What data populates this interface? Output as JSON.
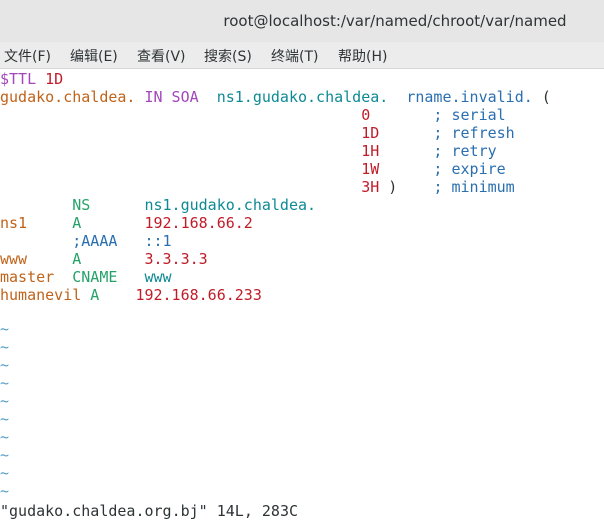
{
  "window": {
    "title": "root@localhost:/var/named/chroot/var/named"
  },
  "menu": [
    "文件(F)",
    "编辑(E)",
    "查看(V)",
    "搜索(S)",
    "终端(T)",
    "帮助(H)"
  ],
  "lines": [
    [
      {
        "t": "$TTL ",
        "c": "c-purple"
      },
      {
        "t": "1D",
        "c": "c-red"
      }
    ],
    [
      {
        "t": "gudako.chaldea.",
        "c": "c-orange"
      },
      {
        "t": " IN SOA  ",
        "c": "c-purple"
      },
      {
        "t": "ns1.gudako.chaldea.",
        "c": "c-teal"
      },
      {
        "t": "  rname.invalid.",
        "c": "c-blue"
      },
      {
        "t": " (",
        "c": "c-default"
      }
    ],
    [
      {
        "t": "                                        0",
        "c": "c-red"
      },
      {
        "t": "       ;",
        "c": "c-blue"
      },
      {
        "t": " serial",
        "c": "c-blue"
      }
    ],
    [
      {
        "t": "                                        1D",
        "c": "c-red"
      },
      {
        "t": "      ;",
        "c": "c-blue"
      },
      {
        "t": " refresh",
        "c": "c-blue"
      }
    ],
    [
      {
        "t": "                                        1H",
        "c": "c-red"
      },
      {
        "t": "      ;",
        "c": "c-blue"
      },
      {
        "t": " retry",
        "c": "c-blue"
      }
    ],
    [
      {
        "t": "                                        1W",
        "c": "c-red"
      },
      {
        "t": "      ;",
        "c": "c-blue"
      },
      {
        "t": " expire",
        "c": "c-blue"
      }
    ],
    [
      {
        "t": "                                        3H",
        "c": "c-red"
      },
      {
        "t": " )    ",
        "c": "c-default"
      },
      {
        "t": ";",
        "c": "c-blue"
      },
      {
        "t": " minimum",
        "c": "c-blue"
      }
    ],
    [
      {
        "t": "        NS      ",
        "c": "c-green"
      },
      {
        "t": "ns1.gudako.chaldea.",
        "c": "c-teal"
      }
    ],
    [
      {
        "t": "ns1     ",
        "c": "c-orange"
      },
      {
        "t": "A       ",
        "c": "c-green"
      },
      {
        "t": "192.168.66.2",
        "c": "c-red"
      }
    ],
    [
      {
        "t": "        ;AAAA   ::1",
        "c": "c-blue"
      }
    ],
    [
      {
        "t": "www     ",
        "c": "c-orange"
      },
      {
        "t": "A       ",
        "c": "c-green"
      },
      {
        "t": "3.3.3.3",
        "c": "c-red"
      }
    ],
    [
      {
        "t": "master  ",
        "c": "c-orange"
      },
      {
        "t": "CNAME   ",
        "c": "c-green"
      },
      {
        "t": "www",
        "c": "c-teal"
      }
    ],
    [
      {
        "t": "humanevil ",
        "c": "c-orange"
      },
      {
        "t": "A    ",
        "c": "c-green"
      },
      {
        "t": "192.168.66.233",
        "c": "c-red"
      }
    ]
  ],
  "tilde_char": "~",
  "tilde_count": 10,
  "status": "\"gudako.chaldea.org.bj\" 14L, 283C"
}
